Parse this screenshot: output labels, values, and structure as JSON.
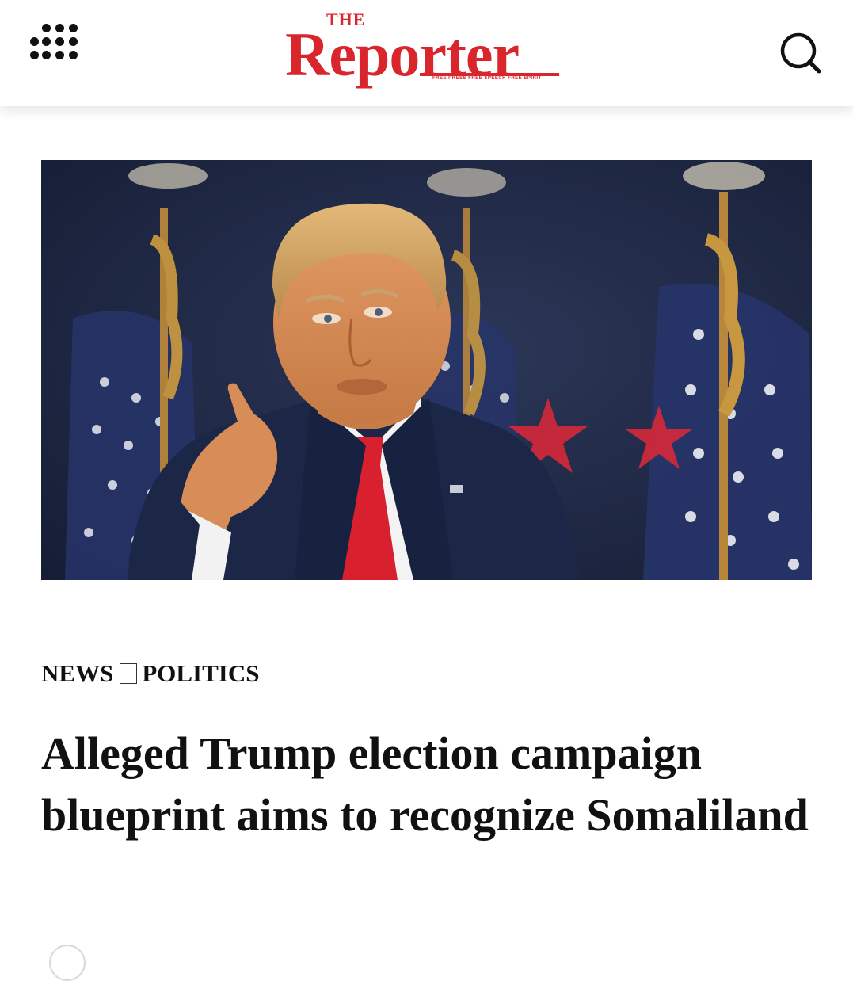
{
  "header": {
    "menu_icon": "grid-dots-icon",
    "logo": {
      "prefix": "THE",
      "name": "Reporter",
      "tagline": "FREE PRESS FREE SPEECH FREE SPIRIT"
    },
    "search_icon": "search-icon"
  },
  "colors": {
    "brand_red": "#d9262d",
    "text": "#111111",
    "background": "#ffffff"
  },
  "article": {
    "breadcrumb": {
      "primary": "NEWS",
      "separator_glyph": "□",
      "secondary": "POLITICS"
    },
    "headline": "Alleged Trump election campaign blueprint aims to recognize Somaliland"
  }
}
